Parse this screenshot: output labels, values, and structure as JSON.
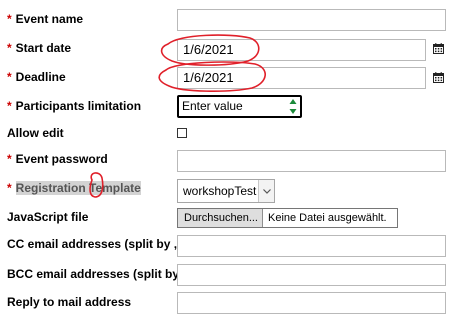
{
  "form": {
    "required_marker": "*",
    "event_name": {
      "label": "Event name",
      "value": ""
    },
    "start_date": {
      "label": "Start date",
      "value": "1/6/2021",
      "icon": "calendar-icon"
    },
    "deadline": {
      "label": "Deadline",
      "value": "1/6/2021",
      "icon": "calendar-icon"
    },
    "participants_limitation": {
      "label": "Participants limitation",
      "placeholder": "Enter value"
    },
    "allow_edit": {
      "label": "Allow edit",
      "checked": false
    },
    "event_password": {
      "label": "Event password",
      "value": ""
    },
    "registration_template": {
      "label_part1": "Registration ",
      "label_part2": "Template",
      "selected": "workshopTest"
    },
    "javascript_file": {
      "label": "JavaScript file",
      "button_label": "Durchsuchen...",
      "status_text": "Keine Datei ausgewählt."
    },
    "cc_email": {
      "label": "CC email addresses (split by ,)",
      "value": ""
    },
    "bcc_email": {
      "label": "BCC email addresses (split by ,)",
      "value": ""
    },
    "reply_to": {
      "label": "Reply to mail address",
      "value": ""
    }
  },
  "colors": {
    "required": "#cc0000",
    "annotation": "#e0202a",
    "label_highlight": "#d3d3d3"
  }
}
